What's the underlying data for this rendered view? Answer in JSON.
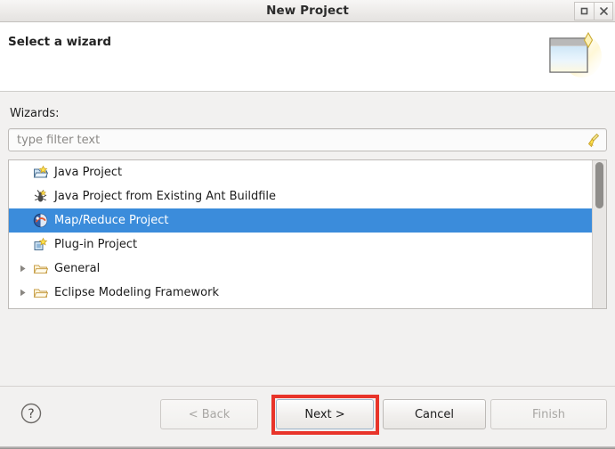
{
  "window": {
    "title": "New Project",
    "controls": [
      {
        "name": "restore-button",
        "glyph": "restore"
      },
      {
        "name": "close-button",
        "glyph": "close"
      }
    ]
  },
  "header": {
    "title": "Select a wizard",
    "icon": "new-project-wizard-icon"
  },
  "body": {
    "wizards_label": "Wizards:",
    "filter": {
      "placeholder": "type filter text",
      "value": "",
      "clear_icon": "broom-clear-icon"
    },
    "list": {
      "items": [
        {
          "label": "Java Project",
          "icon": "java-project-icon",
          "expandable": false,
          "selected": false
        },
        {
          "label": "Java Project from Existing Ant Buildfile",
          "icon": "ant-buildfile-icon",
          "expandable": false,
          "selected": false
        },
        {
          "label": "Map/Reduce Project",
          "icon": "mapreduce-project-icon",
          "expandable": false,
          "selected": true
        },
        {
          "label": "Plug-in Project",
          "icon": "plugin-project-icon",
          "expandable": false,
          "selected": false
        },
        {
          "label": "General",
          "icon": "folder-icon",
          "expandable": true,
          "selected": false
        },
        {
          "label": "Eclipse Modeling Framework",
          "icon": "folder-icon",
          "expandable": true,
          "selected": false
        }
      ],
      "scrollbar": {
        "name": "list-scrollbar"
      }
    }
  },
  "footer": {
    "help_icon": "help-question-icon",
    "buttons": [
      {
        "name": "back-button",
        "label": "< Back",
        "enabled": false,
        "highlighted": false
      },
      {
        "name": "next-button",
        "label": "Next >",
        "enabled": true,
        "highlighted": true
      },
      {
        "name": "cancel-button",
        "label": "Cancel",
        "enabled": true,
        "highlighted": false
      },
      {
        "name": "finish-button",
        "label": "Finish",
        "enabled": false,
        "highlighted": false
      }
    ]
  },
  "colors": {
    "selection_blue": "#3b8cdb",
    "highlight_red": "#e8342a",
    "dialog_bg": "#f2f1f0",
    "list_bg": "#ffffff"
  }
}
